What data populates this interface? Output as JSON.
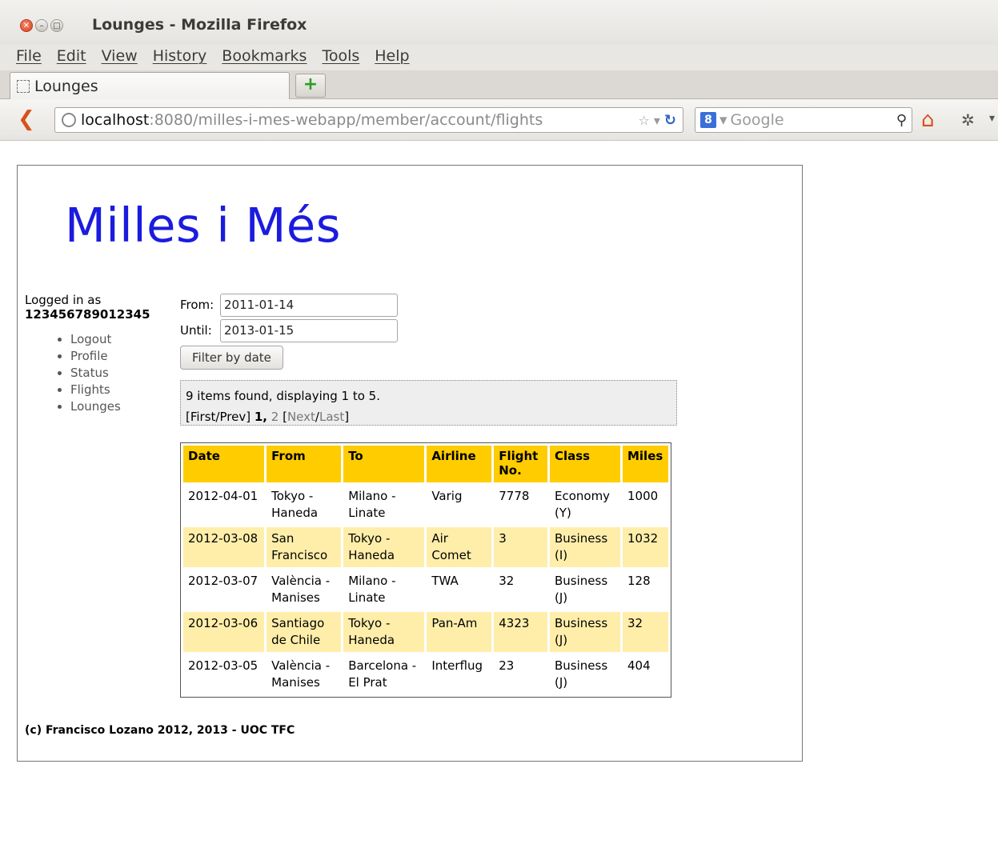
{
  "window": {
    "title": "Lounges - Mozilla Firefox"
  },
  "menu": [
    "File",
    "Edit",
    "View",
    "History",
    "Bookmarks",
    "Tools",
    "Help"
  ],
  "tab": {
    "title": "Lounges",
    "new_tab": "+"
  },
  "nav": {
    "url_host": "localhost",
    "url_rest": ":8080/milles-i-mes-webapp/member/account/flights",
    "search_placeholder": "Google"
  },
  "site": {
    "title": "Milles i Més"
  },
  "user": {
    "logged_in_label": "Logged in as",
    "id": "123456789012345"
  },
  "sidebar": {
    "items": [
      "Logout",
      "Profile",
      "Status",
      "Flights",
      "Lounges"
    ]
  },
  "filter": {
    "from_label": "From:",
    "from_value": "2011-01-14",
    "until_label": "Until:",
    "until_value": "2013-01-15",
    "button": "Filter by date"
  },
  "pager": {
    "summary": "9 items found, displaying 1 to 5.",
    "first_prev": "[First/Prev]",
    "page_current": "1",
    "page_sep": ",",
    "page_next": "2",
    "open_bracket": "[",
    "next_link": "Next",
    "slash": "/",
    "last_link": "Last",
    "close_bracket": "]"
  },
  "table": {
    "headers": [
      "Date",
      "From",
      "To",
      "Airline",
      "Flight No.",
      "Class",
      "Miles"
    ],
    "rows": [
      [
        "2012-04-01",
        "Tokyo - Haneda",
        "Milano - Linate",
        "Varig",
        "7778",
        "Economy (Y)",
        "1000"
      ],
      [
        "2012-03-08",
        "San Francisco",
        "Tokyo - Haneda",
        "Air Comet",
        "3",
        "Business (I)",
        "1032"
      ],
      [
        "2012-03-07",
        "València - Manises",
        "Milano - Linate",
        "TWA",
        "32",
        "Business (J)",
        "128"
      ],
      [
        "2012-03-06",
        "Santiago de Chile",
        "Tokyo - Haneda",
        "Pan-Am",
        "4323",
        "Business (J)",
        "32"
      ],
      [
        "2012-03-05",
        "València - Manises",
        "Barcelona - El Prat",
        "Interflug",
        "23",
        "Business (J)",
        "404"
      ]
    ]
  },
  "footer": {
    "text": "(c) Francisco Lozano 2012, 2013 - UOC TFC"
  }
}
